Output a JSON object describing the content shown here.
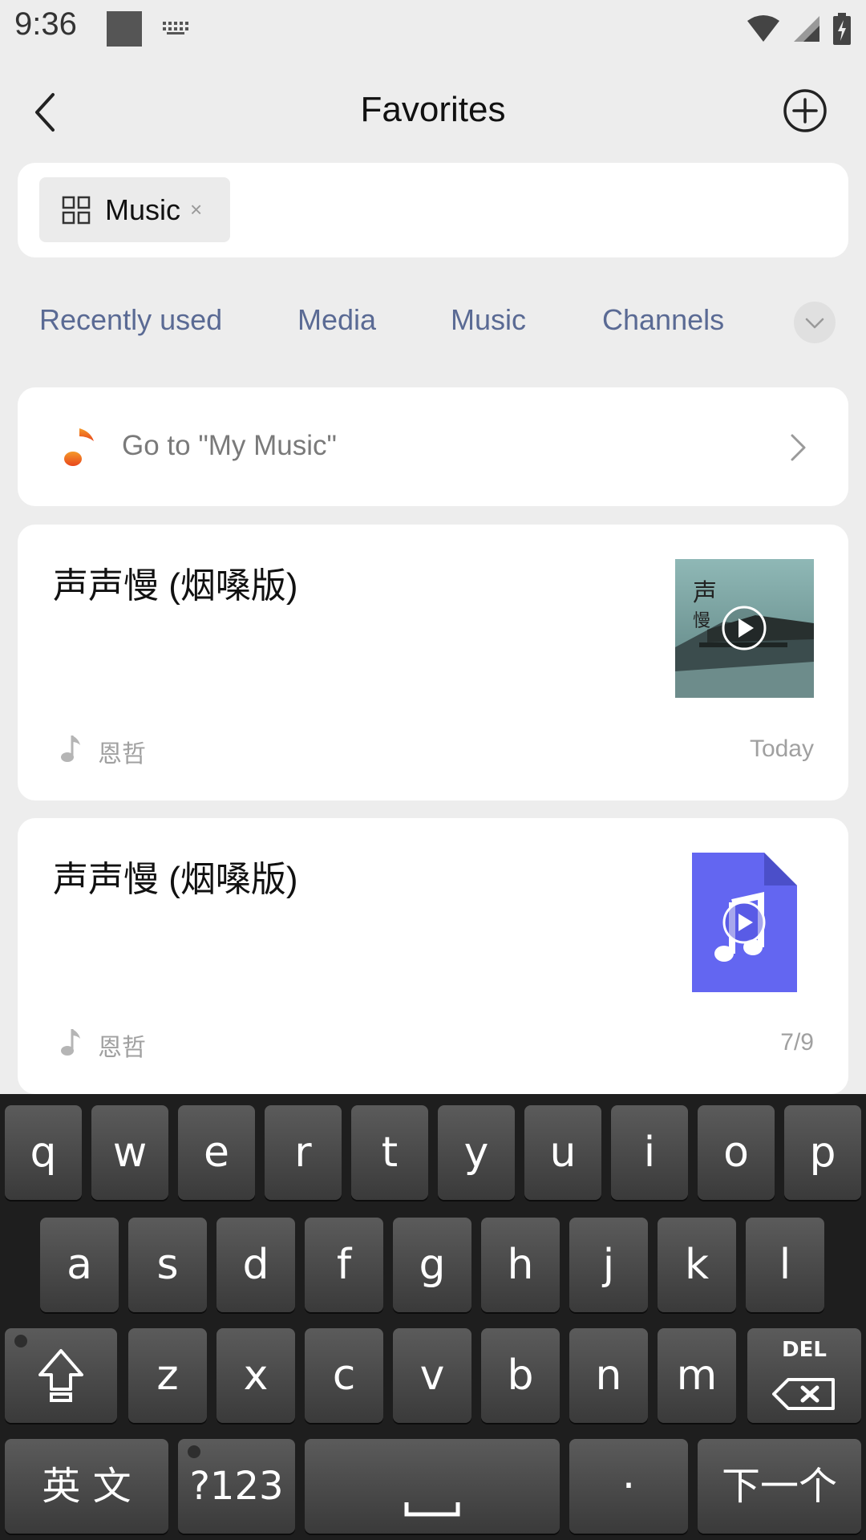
{
  "status_bar": {
    "time": "9:36"
  },
  "header": {
    "title": "Favorites"
  },
  "filter": {
    "chip_label": "Music",
    "chip_close": "×"
  },
  "tabs": [
    "Recently used",
    "Media",
    "Music",
    "Channels"
  ],
  "go_my_music": {
    "label": "Go to \"My Music\""
  },
  "items": [
    {
      "title": "声声慢 (烟嗓版)",
      "artist": "恩哲",
      "date": "Today",
      "thumb": "album-cover"
    },
    {
      "title": "声声慢 (烟嗓版)",
      "artist": "恩哲",
      "date": "7/9",
      "thumb": "music-file-icon"
    }
  ],
  "keyboard": {
    "row1": [
      "q",
      "w",
      "e",
      "r",
      "t",
      "y",
      "u",
      "i",
      "o",
      "p"
    ],
    "row2": [
      "a",
      "s",
      "d",
      "f",
      "g",
      "h",
      "j",
      "k",
      "l"
    ],
    "row3": [
      "z",
      "x",
      "c",
      "v",
      "b",
      "n",
      "m"
    ],
    "lang_label": "英 文",
    "symbols_label": "?123",
    "period_label": "·",
    "enter_label": "下一个",
    "del_label": "DEL"
  },
  "colors": {
    "accent_tab": "#5a6a94",
    "music_icon": "#f06a28",
    "file_icon": "#6366f1"
  }
}
